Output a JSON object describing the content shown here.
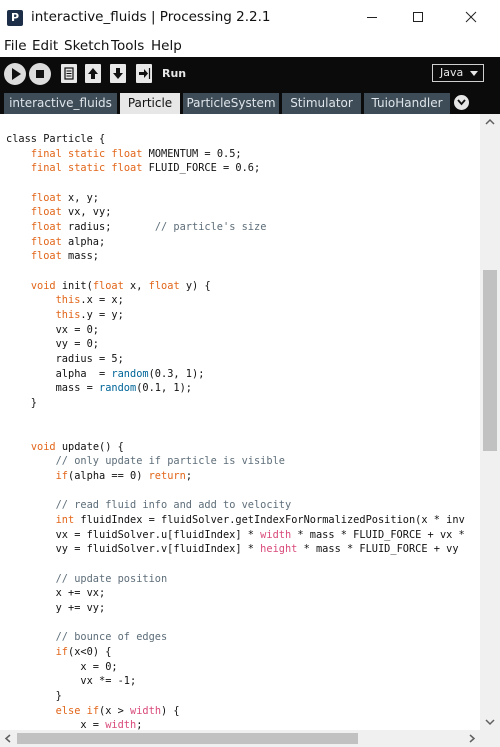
{
  "window": {
    "title": "interactive_fluids | Processing 2.2.1",
    "app_icon_letter": "P",
    "controls": [
      "minimize-icon",
      "maximize-icon",
      "close-icon"
    ]
  },
  "menu": [
    "File",
    "Edit",
    "Sketch",
    "Tools",
    "Help"
  ],
  "toolbar": {
    "run_label": "Run",
    "mode": "Java",
    "buttons": [
      "play-icon",
      "stop-icon",
      "new-icon",
      "open-icon",
      "save-icon",
      "export-icon"
    ]
  },
  "tabs": [
    {
      "label": "interactive_fluids",
      "active": false
    },
    {
      "label": "Particle",
      "active": true
    },
    {
      "label": "ParticleSystem",
      "active": false
    },
    {
      "label": "Stimulator",
      "active": false
    },
    {
      "label": "TuioHandler",
      "active": false
    }
  ],
  "editor": {
    "lines": [
      "class Particle {",
      "    final static float MOMENTUM = 0.5;",
      "    final static float FLUID_FORCE = 0.6;",
      "",
      "    float x, y;",
      "    float vx, vy;",
      "    float radius;       // particle's size",
      "    float alpha;",
      "    float mass;",
      "",
      "    void init(float x, float y) {",
      "        this.x = x;",
      "        this.y = y;",
      "        vx = 0;",
      "        vy = 0;",
      "        radius = 5;",
      "        alpha  = random(0.3, 1);",
      "        mass = random(0.1, 1);",
      "    }",
      "",
      "",
      "    void update() {",
      "        // only update if particle is visible",
      "        if(alpha == 0) return;",
      "",
      "        // read fluid info and add to velocity",
      "        int fluidIndex = fluidSolver.getIndexForNormalizedPosition(x * inv",
      "        vx = fluidSolver.u[fluidIndex] * width * mass * FLUID_FORCE + vx *",
      "        vy = fluidSolver.v[fluidIndex] * height * mass * FLUID_FORCE + vy",
      "",
      "        // update position",
      "        x += vx;",
      "        y += vy;",
      "",
      "        // bounce of edges",
      "        if(x<0) {",
      "            x = 0;",
      "            vx *= -1;",
      "        }",
      "        else if(x > width) {",
      "            x = width;"
    ]
  },
  "colors": {
    "keyword": "#e2661a",
    "comment": "#5e6e7a",
    "function": "#006699",
    "builtin_var": "#d94a7a",
    "toolbar_bg": "#0b0b0b",
    "tab_bg": "#3d4c57",
    "tab_active_bg": "#e7e7e7"
  }
}
